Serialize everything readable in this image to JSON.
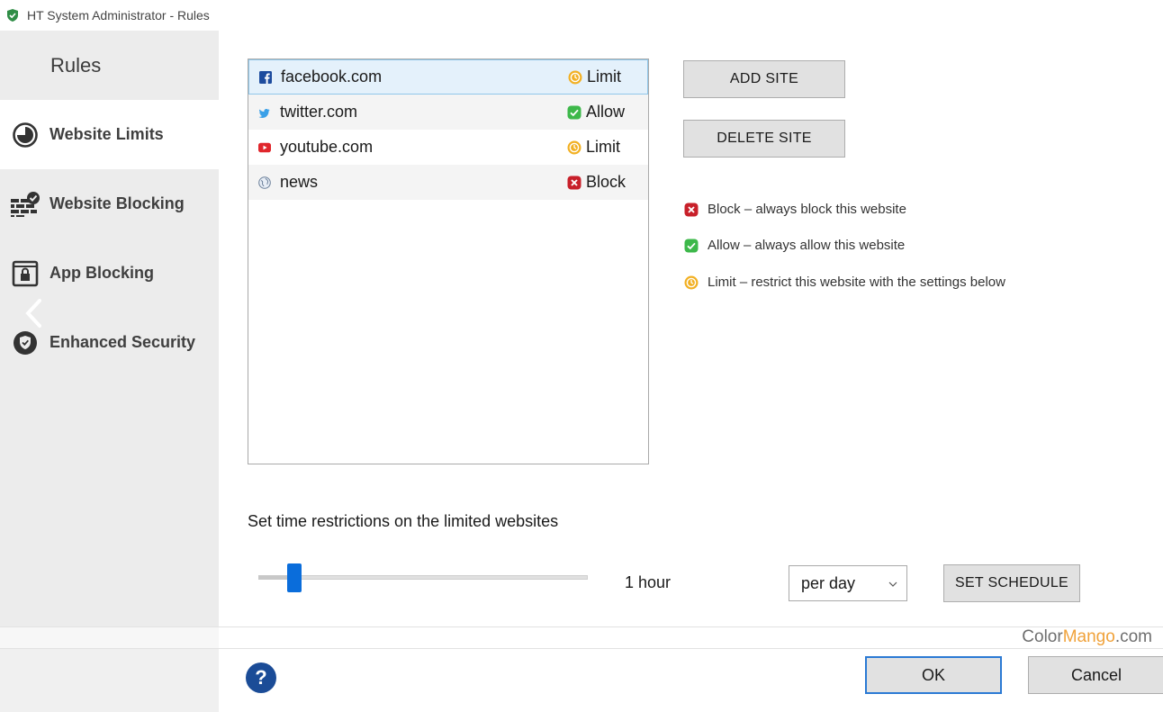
{
  "window": {
    "title": "HT System Administrator - Rules"
  },
  "sidebar": {
    "header": "Rules",
    "items": [
      {
        "label": "Website Limits",
        "icon": "clock-icon",
        "active": true
      },
      {
        "label": "Website Blocking",
        "icon": "brick-wall-check-icon",
        "active": false
      },
      {
        "label": "App Blocking",
        "icon": "app-lock-icon",
        "active": false
      },
      {
        "label": "Enhanced Security",
        "icon": "shield-check-icon",
        "active": false
      }
    ]
  },
  "sites": [
    {
      "name": "facebook.com",
      "icon": "facebook-icon",
      "status": "Limit",
      "selected": true
    },
    {
      "name": "twitter.com",
      "icon": "twitter-icon",
      "status": "Allow",
      "selected": false
    },
    {
      "name": "youtube.com",
      "icon": "youtube-icon",
      "status": "Limit",
      "selected": false
    },
    {
      "name": "news",
      "icon": "globe-icon",
      "status": "Block",
      "selected": false
    }
  ],
  "buttons": {
    "add_site": "ADD SITE",
    "delete_site": "DELETE SITE",
    "set_schedule": "SET SCHEDULE",
    "ok": "OK",
    "cancel": "Cancel",
    "help": "?"
  },
  "legend": {
    "block": "Block – always block this website",
    "allow": "Allow – always allow this website",
    "limit": "Limit – restrict this website with the settings below"
  },
  "restrictions": {
    "label": "Set time restrictions on the limited websites",
    "slider_fraction": 0.11,
    "duration": "1 hour",
    "period": "per day"
  },
  "watermark": {
    "prefix": "Color",
    "accent": "Mango",
    "suffix": ".com"
  },
  "colors": {
    "block": "#c8202a",
    "allow": "#3db84a",
    "limit": "#f2b023",
    "accent": "#0a6ddb",
    "selected_row": "#e4f1fb"
  }
}
